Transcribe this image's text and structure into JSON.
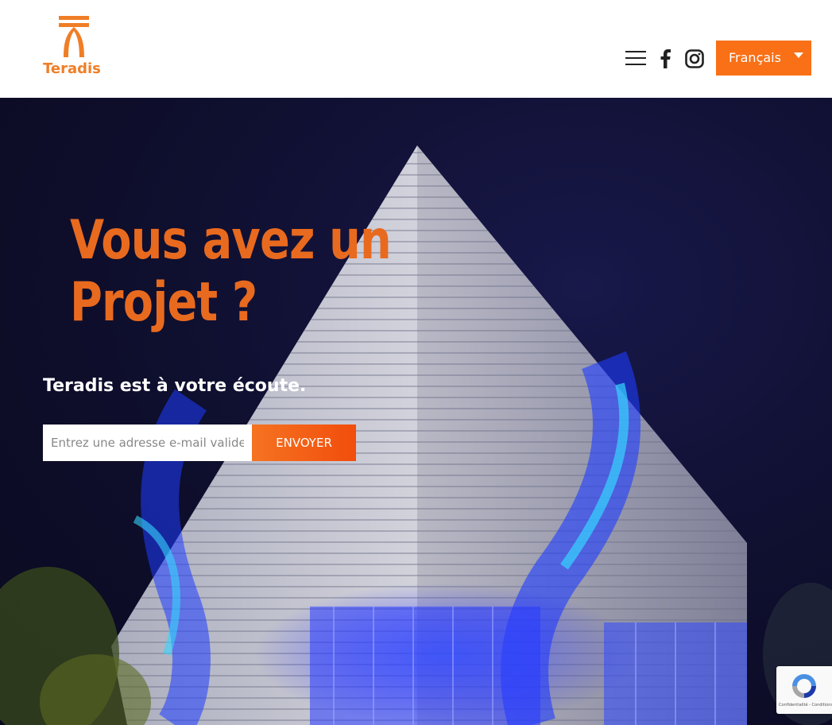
{
  "header": {
    "logo_text": "Teradis",
    "language_label": "Français",
    "brand_color": "#f97016"
  },
  "icons": {
    "menu": "hamburger-menu-icon",
    "facebook": "facebook-icon",
    "instagram": "instagram-icon",
    "dropdown": "caret-down-icon",
    "recaptcha": "recaptcha-icon"
  },
  "hero": {
    "headline_line1": "Vous avez un",
    "headline_line2": "Projet ?",
    "headline_color": "#e86a1f",
    "tagline": "Teradis est à votre écoute.",
    "email_placeholder": "Entrez une adresse e-mail valide",
    "email_value": "",
    "send_label": "ENVOYER"
  },
  "recaptcha": {
    "footer_text": "Confidentialité - Conditions"
  }
}
